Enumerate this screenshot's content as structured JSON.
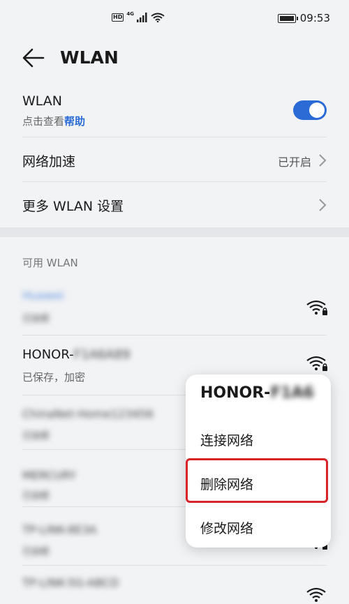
{
  "status_bar": {
    "hd": "HD",
    "network": "4G",
    "time": "09:53"
  },
  "header": {
    "title": "WLAN"
  },
  "wlan_toggle": {
    "title": "WLAN",
    "subtitle_prefix": "点击查看",
    "help_link": "帮助",
    "enabled": true
  },
  "network_accel": {
    "title": "网络加速",
    "value": "已开启"
  },
  "more_settings": {
    "title": "更多 WLAN 设置"
  },
  "available": {
    "section_label": "可用 WLAN",
    "networks": [
      {
        "name": "Huawei",
        "status": "已加密"
      },
      {
        "name_prefix": "HONOR-",
        "name_suffix": "F1A6A89",
        "status": "已保存，加密"
      },
      {
        "name": "ChinaNet-Home123456",
        "status": "已加密"
      },
      {
        "name": "MERCURY",
        "status": "已加密"
      },
      {
        "name": "TP-LINK-8E3A",
        "status": "已加密"
      },
      {
        "name": "TP-LINK-5G-ABCD",
        "status": ""
      }
    ]
  },
  "popup": {
    "title_prefix": "HONOR-",
    "title_suffix": "F1A6",
    "items": [
      "连接网络",
      "删除网络",
      "修改网络"
    ]
  },
  "colors": {
    "accent": "#2a6bd6",
    "highlight": "#d8232a",
    "background": "#f1f3f5"
  }
}
